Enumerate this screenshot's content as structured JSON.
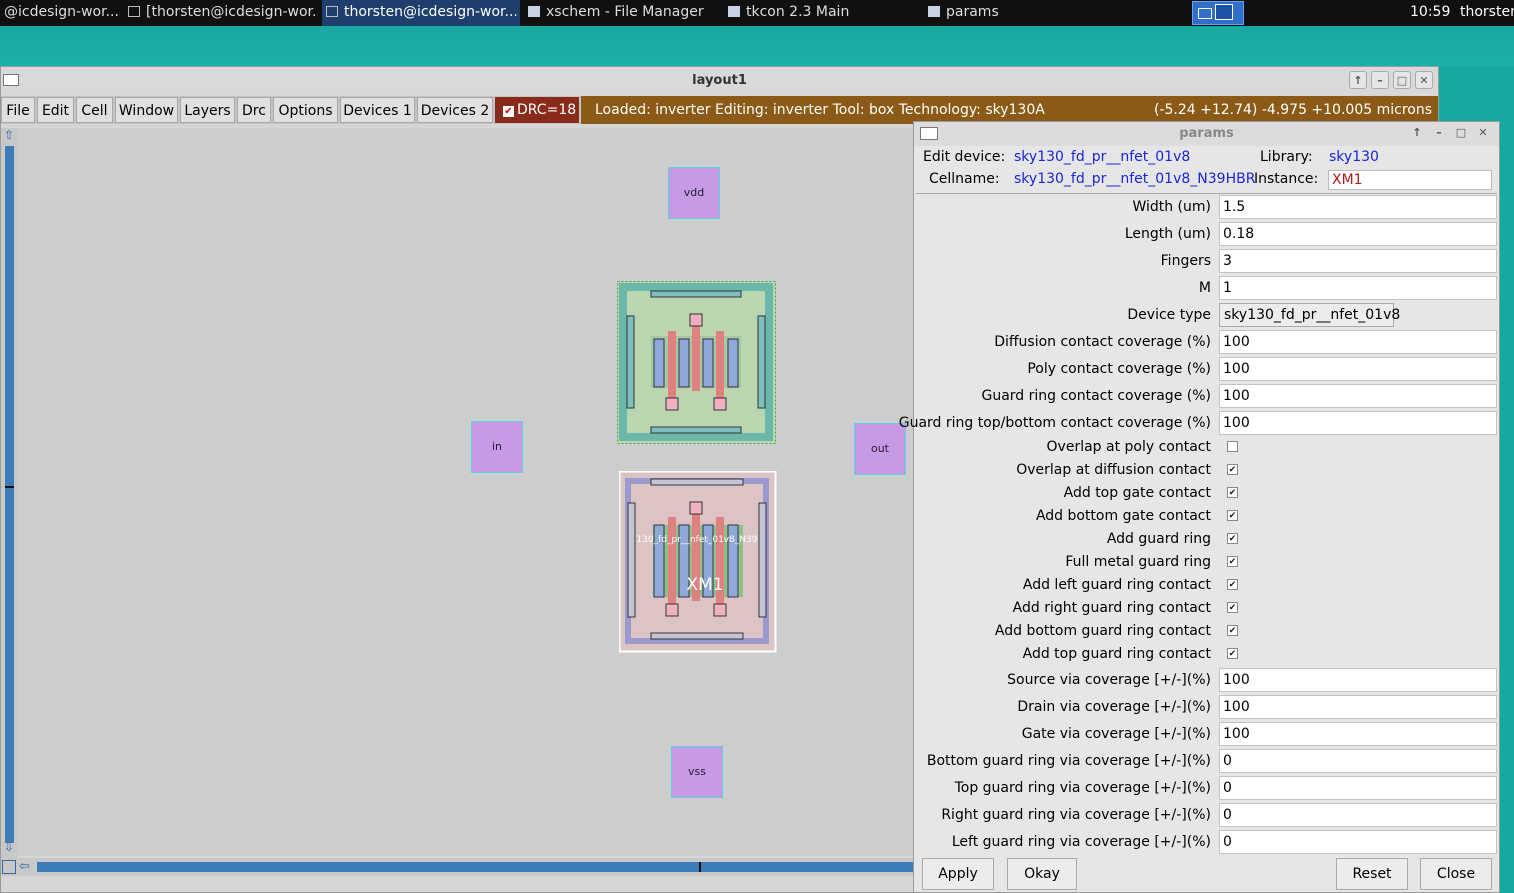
{
  "taskbar": {
    "items": [
      {
        "label": "@icdesign-wor..."
      },
      {
        "label": "[thorsten@icdesign-wor..."
      },
      {
        "label": "thorsten@icdesign-wor..."
      },
      {
        "label": "xschem - File Manager"
      },
      {
        "label": "tkcon 2.3 Main"
      },
      {
        "label": "params"
      }
    ],
    "clock": "10:59",
    "user": "thorster"
  },
  "main_window": {
    "title": "layout1",
    "menus": [
      "File",
      "Edit",
      "Cell",
      "Window",
      "Layers",
      "Drc",
      "Options",
      "Devices 1",
      "Devices 2"
    ],
    "drc": "DRC=18",
    "status": "Loaded: inverter Editing: inverter Tool: box  Technology: sky130A",
    "coords": "(-5.24 +12.74) -4.975 +10.005 microns"
  },
  "layout": {
    "pins": [
      "vdd",
      "in",
      "out",
      "vss"
    ],
    "cell_label": "130_fd_pr__nfet_01v8_N39",
    "instance_label": "XM1"
  },
  "params": {
    "title": "params",
    "edit_device_label": "Edit device:",
    "edit_device": "sky130_fd_pr__nfet_01v8",
    "library_label": "Library:",
    "library": "sky130",
    "cellname_label": "Cellname:",
    "cellname": "sky130_fd_pr__nfet_01v8_N39HBR",
    "instance_label": "Instance:",
    "instance": "XM1",
    "fields_top": [
      {
        "label": "Width (um)",
        "value": "1.5"
      },
      {
        "label": "Length (um)",
        "value": "0.18"
      },
      {
        "label": "Fingers",
        "value": "3"
      },
      {
        "label": "M",
        "value": "1"
      }
    ],
    "device_type_label": "Device type",
    "device_type": "sky130_fd_pr__nfet_01v8",
    "fields_cov": [
      {
        "label": "Diffusion contact coverage (%)",
        "value": "100"
      },
      {
        "label": "Poly contact coverage (%)",
        "value": "100"
      },
      {
        "label": "Guard ring contact coverage (%)",
        "value": "100"
      },
      {
        "label": "Guard ring top/bottom contact coverage (%)",
        "value": "100"
      }
    ],
    "checkboxes": [
      {
        "label": "Overlap at poly contact",
        "checked": false
      },
      {
        "label": "Overlap at diffusion contact",
        "checked": true
      },
      {
        "label": "Add top gate contact",
        "checked": true
      },
      {
        "label": "Add bottom gate contact",
        "checked": true
      },
      {
        "label": "Add guard ring",
        "checked": true
      },
      {
        "label": "Full metal guard ring",
        "checked": true
      },
      {
        "label": "Add left guard ring contact",
        "checked": true
      },
      {
        "label": "Add right guard ring contact",
        "checked": true
      },
      {
        "label": "Add bottom guard ring contact",
        "checked": true
      },
      {
        "label": "Add top guard ring contact",
        "checked": true
      }
    ],
    "fields_via": [
      {
        "label": "Source via coverage [+/-](%)",
        "value": "100"
      },
      {
        "label": "Drain via coverage [+/-](%)",
        "value": "100"
      },
      {
        "label": "Gate via coverage [+/-](%)",
        "value": "100"
      },
      {
        "label": "Bottom guard ring via coverage [+/-](%)",
        "value": "0"
      },
      {
        "label": "Top guard ring via coverage [+/-](%)",
        "value": "0"
      },
      {
        "label": "Right guard ring via coverage [+/-](%)",
        "value": "0"
      },
      {
        "label": "Left guard ring via coverage [+/-](%)",
        "value": "0"
      }
    ],
    "buttons": {
      "apply": "Apply",
      "okay": "Okay",
      "reset": "Reset",
      "close": "Close"
    }
  },
  "colors": {
    "desktop": "#17a8a4",
    "status_bar": "#8a5a16",
    "drc_bar": "#8a2a1a",
    "pin": "#c79ae6",
    "link_blue": "#1a24d8"
  }
}
